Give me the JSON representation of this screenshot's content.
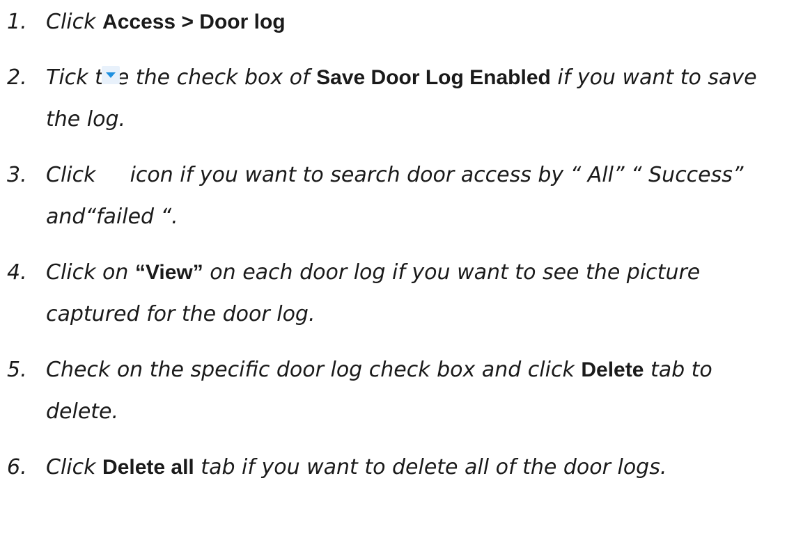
{
  "steps": [
    {
      "number": "1.",
      "pre": "Click ",
      "bold": "Access > Door log"
    },
    {
      "number": "2.",
      "pre": "Tick the the check box of ",
      "bold": "Save Door Log Enabled",
      "post": " if you want to save",
      "continuation": "the log."
    },
    {
      "number": "3.",
      "pre": "Click ",
      "icon": "dropdown-arrow-icon",
      "post": " icon if you want to search door access by “ All” “ Success”",
      "continuation": "and“failed “."
    },
    {
      "number": "4.",
      "pre": "Click on ",
      "bold": "“View”",
      "post": " on each door log if you want to see the picture",
      "continuation": "captured for the door log."
    },
    {
      "number": "5.",
      "pre": "Check on the specific door log check box and click ",
      "bold": "Delete",
      "post": " tab to",
      "continuation": "delete."
    },
    {
      "number": "6.",
      "pre": "Click ",
      "bold": "Delete all",
      "post": " tab if you want to delete all of the door logs."
    }
  ],
  "colors": {
    "text": "#1a1a1a",
    "icon_arrow": "#1e90e0",
    "icon_bg": "#e8f1fb"
  }
}
